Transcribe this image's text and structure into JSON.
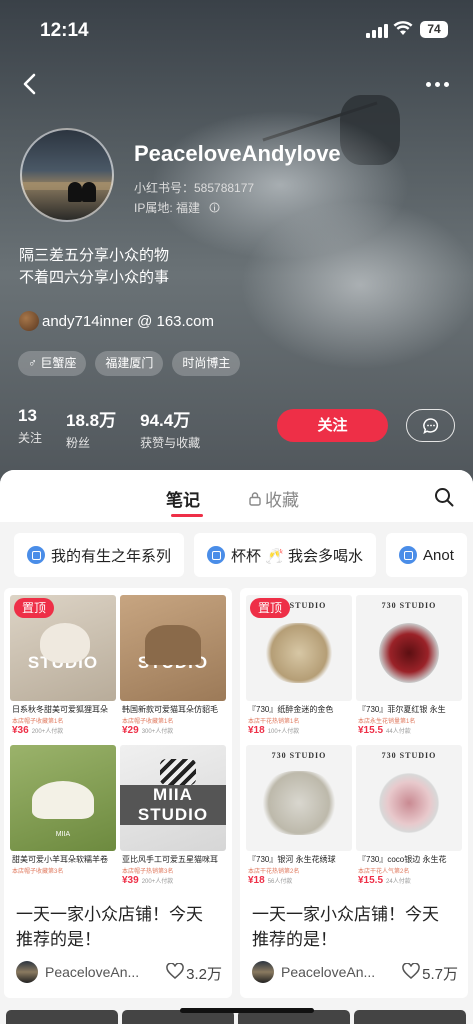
{
  "status": {
    "time": "12:14",
    "battery": "74"
  },
  "profile": {
    "username": "PeaceloveAndylove",
    "xhs_id": "小红书号：585788177",
    "ip": "IP属地: 福建",
    "bio_line1": "隔三差五分享小众的物",
    "bio_line2": "不着四六分享小众的事",
    "email": "andy714inner @ 163.com",
    "tags": [
      "♂ 巨蟹座",
      "福建厦门",
      "时尚博主"
    ]
  },
  "stats": [
    {
      "value": "13",
      "label": "关注"
    },
    {
      "value": "18.8万",
      "label": "粉丝"
    },
    {
      "value": "94.4万",
      "label": "获赞与收藏"
    }
  ],
  "actions": {
    "follow": "关注"
  },
  "tabs": {
    "notes": "笔记",
    "collections": "收藏"
  },
  "collections": [
    "我的有生之年系列",
    "杯杯 🥂 我会多喝水",
    "Anot"
  ],
  "pinned_label": "置顶",
  "cards": [
    {
      "title_line1": "一天一家小众店铺！今天",
      "title_line2": "推荐的是！",
      "author": "PeaceloveAn...",
      "likes": "3.2万",
      "items": [
        {
          "caption": "日系秋冬甜美可爱狐狸耳朵",
          "sub": "本店帽子收藏第1名",
          "price": "¥36",
          "sold": "200+人付款",
          "brand": "MIIA STUDIO"
        },
        {
          "caption": "韩国新款可爱猫耳朵仿貂毛",
          "sub": "本店帽子收藏第1名",
          "price": "¥29",
          "sold": "300+人付款",
          "brand": "MIIA STUDIO"
        },
        {
          "caption": "甜美可爱小羊耳朵软糯羊卷",
          "sub": "本店帽子收藏第3名",
          "price": "",
          "sold": "",
          "brand": "MIIA"
        },
        {
          "caption": "亚比风手工可爱五星猫咪耳",
          "sub": "本店帽子热销第3名",
          "price": "¥39",
          "sold": "200+人付款",
          "brand": "MIIA STUDIO"
        }
      ]
    },
    {
      "title_line1": "一天一家小众店铺！今天",
      "title_line2": "推荐的是！",
      "author": "PeaceloveAn...",
      "likes": "5.7万",
      "items": [
        {
          "caption": "『730』纸醉金迷的金色",
          "sub": "本店干花热销第1名",
          "price": "¥18",
          "sold": "100+人付款",
          "brand": "730 STUDIO"
        },
        {
          "caption": "『730』菲尔夏红银 永生",
          "sub": "本店永生花销量第1名",
          "price": "¥15.5",
          "sold": "44人付款",
          "brand": "730 STUDIO"
        },
        {
          "caption": "『730』银河 永生花绣球",
          "sub": "本店干花热销第2名",
          "price": "¥18",
          "sold": "56人付款",
          "brand": "730 STUDIO"
        },
        {
          "caption": "『730』coco银边 永生花",
          "sub": "本店干花人气第2名",
          "price": "¥15.5",
          "sold": "24人付款",
          "brand": "730 STUDIO"
        }
      ]
    }
  ],
  "colors": {
    "accent": "#ee2f47",
    "link_blue": "#4a8de8"
  },
  "icons": [
    "back-icon",
    "more-icon",
    "info-icon",
    "chat-icon",
    "lock-icon",
    "search-icon",
    "heart-icon",
    "collection-icon"
  ]
}
